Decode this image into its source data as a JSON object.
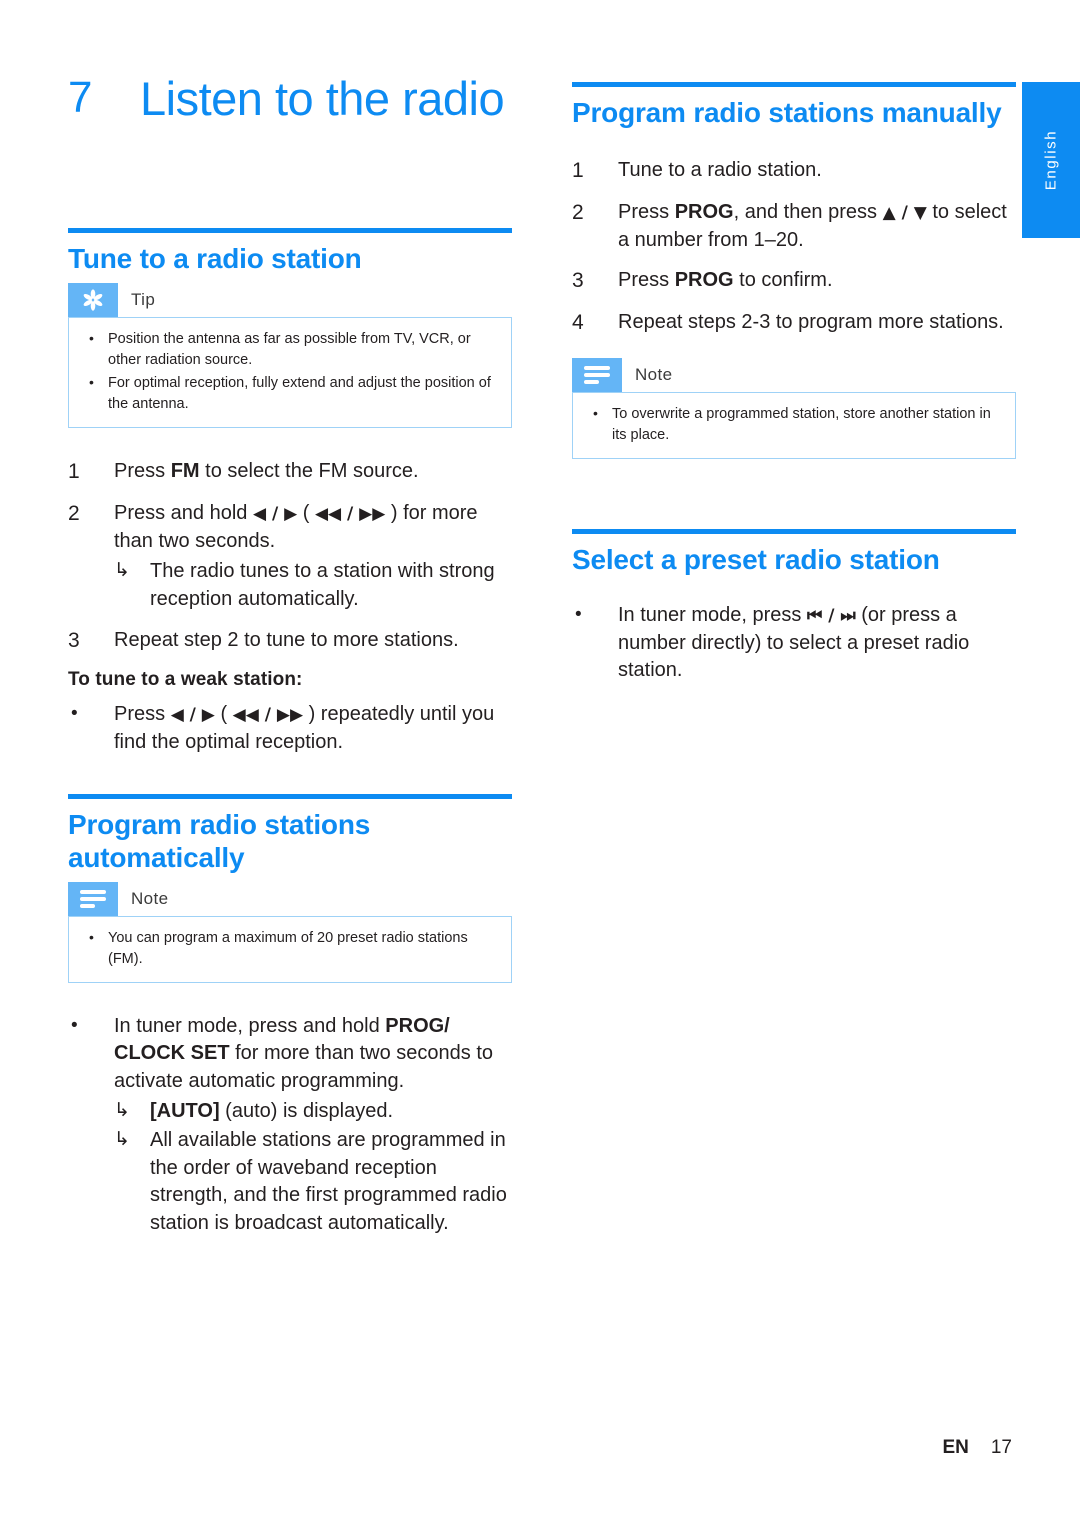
{
  "colors": {
    "accent": "#0d8bf2",
    "callout_icon_bg": "#64b5f6",
    "callout_border": "#9fd2f7",
    "text": "#231f20"
  },
  "language_tab": {
    "label": "English"
  },
  "chapter": {
    "number": "7",
    "title": "Listen to the radio"
  },
  "left_column": {
    "section_tune": {
      "heading": "Tune to a radio station",
      "tip": {
        "icon": "asterisk-icon",
        "title": "Tip",
        "items": [
          "Position the antenna as far as possible from TV, VCR, or other radiation source.",
          "For optimal reception, fully extend and adjust the position of the antenna."
        ]
      },
      "steps": [
        {
          "number": "1",
          "text_parts": [
            {
              "text": "Press ",
              "bold": false
            },
            {
              "text": "FM",
              "bold": true
            },
            {
              "text": " to select the FM source.",
              "bold": false
            }
          ]
        },
        {
          "number": "2",
          "text_parts": [
            {
              "text": "Press and hold ",
              "bold": false
            },
            {
              "text": "◀ / ▶",
              "bold": true,
              "symbol": true
            },
            {
              "text": " ( ",
              "bold": false
            },
            {
              "text": "◀◀ / ▶▶",
              "bold": true,
              "symbol": true
            },
            {
              "text": " ) for more than two seconds.",
              "bold": false
            }
          ],
          "results": [
            "The radio tunes to a station with strong reception automatically."
          ]
        },
        {
          "number": "3",
          "text_parts": [
            {
              "text": "Repeat step 2 to tune to more stations.",
              "bold": false
            }
          ]
        }
      ],
      "subheading": "To tune to a weak station:",
      "weak_station_bullet": {
        "mark": "•",
        "text_parts": [
          {
            "text": "Press ",
            "bold": false
          },
          {
            "text": "◀ / ▶",
            "bold": true,
            "symbol": true
          },
          {
            "text": " ( ",
            "bold": false
          },
          {
            "text": "◀◀ / ▶▶",
            "bold": true,
            "symbol": true
          },
          {
            "text": " ) repeatedly until you find the optimal reception.",
            "bold": false
          }
        ]
      }
    },
    "section_auto": {
      "heading": "Program radio stations automatically",
      "note": {
        "icon": "note-lines-icon",
        "title": "Note",
        "items": [
          "You can program a maximum of 20 preset radio stations (FM)."
        ]
      },
      "bullet": {
        "mark": "•",
        "text_parts": [
          {
            "text": "In tuner mode, press and hold ",
            "bold": false
          },
          {
            "text": "PROG/ CLOCK SET",
            "bold": true
          },
          {
            "text": " for more than two seconds to activate automatic programming.",
            "bold": false
          }
        ],
        "results": [
          [
            {
              "text": "[AUTO]",
              "bold": true
            },
            {
              "text": " (auto) is displayed.",
              "bold": false
            }
          ],
          [
            {
              "text": "All available stations are programmed in the order of waveband reception strength, and the first programmed radio station is broadcast automatically.",
              "bold": false
            }
          ]
        ]
      }
    }
  },
  "right_column": {
    "section_manual": {
      "heading": "Program radio stations manually",
      "steps": [
        {
          "number": "1",
          "text_parts": [
            {
              "text": "Tune to a radio station.",
              "bold": false
            }
          ]
        },
        {
          "number": "2",
          "text_parts": [
            {
              "text": "Press ",
              "bold": false
            },
            {
              "text": "PROG",
              "bold": true
            },
            {
              "text": ", and then press ",
              "bold": false
            },
            {
              "text": "▲ / ▼",
              "bold": true,
              "symbol": true
            },
            {
              "text": " to select a number from 1–20.",
              "bold": false
            }
          ]
        },
        {
          "number": "3",
          "text_parts": [
            {
              "text": "Press ",
              "bold": false
            },
            {
              "text": "PROG",
              "bold": true
            },
            {
              "text": " to confirm.",
              "bold": false
            }
          ]
        },
        {
          "number": "4",
          "text_parts": [
            {
              "text": "Repeat steps 2-3 to program more stations.",
              "bold": false
            }
          ]
        }
      ],
      "note": {
        "icon": "note-lines-icon",
        "title": "Note",
        "items": [
          "To overwrite a programmed station, store another station in its place."
        ]
      }
    },
    "section_preset": {
      "heading": "Select a preset radio station",
      "bullet": {
        "mark": "•",
        "text_parts": [
          {
            "text": "In tuner mode, press ",
            "bold": false
          },
          {
            "text": "⏮ / ⏭",
            "bold": true,
            "symbol": true
          },
          {
            "text": " (or press a number directly) to select a preset radio station.",
            "bold": false
          }
        ]
      }
    }
  },
  "footer": {
    "language_code": "EN",
    "page_number": "17"
  }
}
